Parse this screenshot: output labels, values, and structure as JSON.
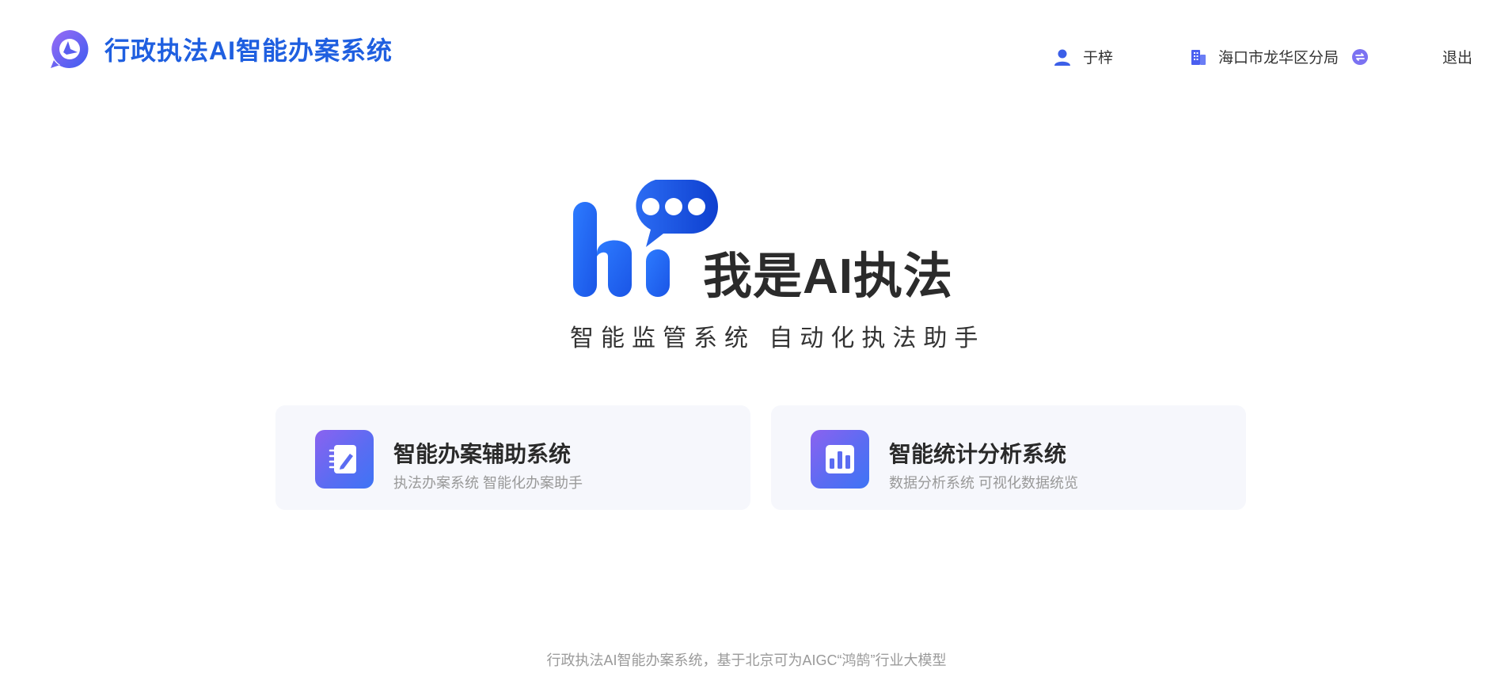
{
  "header": {
    "title": "行政执法AI智能办案系统",
    "user_name": "于梓",
    "org_name": "海口市龙华区分局",
    "logout_label": "退出"
  },
  "hero": {
    "title": "我是AI执法",
    "subtitle": "智能监管系统 自动化执法助手"
  },
  "cards": [
    {
      "title": "智能办案辅助系统",
      "desc": "执法办案系统 智能化办案助手",
      "icon": "notebook-edit-icon"
    },
    {
      "title": "智能统计分析系统",
      "desc": "数据分析系统 可视化数据统览",
      "icon": "bar-chart-icon"
    }
  ],
  "footer": {
    "text": "行政执法AI智能办案系统，基于北京可为AIGC“鸿鹄”行业大模型"
  },
  "colors": {
    "brand": "#1f5fe0",
    "accent": "#5b6cf2",
    "card_bg": "#f6f7fc"
  }
}
